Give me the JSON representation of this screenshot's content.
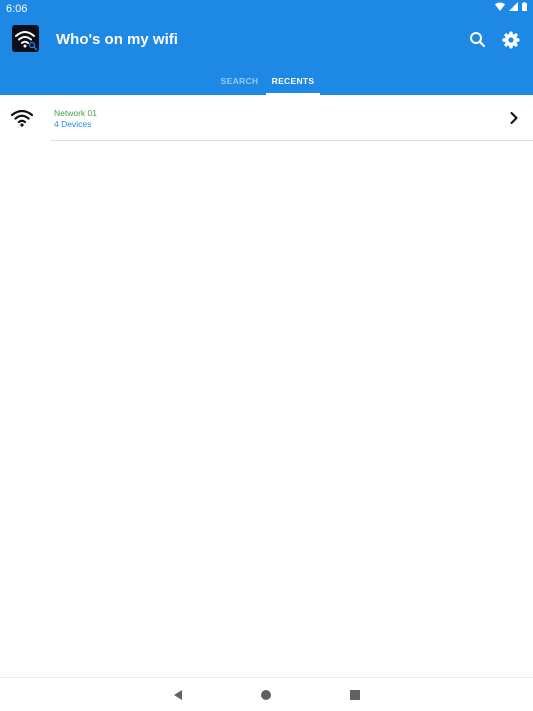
{
  "status_bar": {
    "time": "6:06",
    "icons": [
      "wifi-icon",
      "signal-icon",
      "battery-icon"
    ]
  },
  "app_bar": {
    "title": "Who's on my wifi",
    "actions": [
      "search-icon",
      "gear-icon"
    ],
    "color": "#1e88e5"
  },
  "tabs": [
    {
      "label": "SEARCH",
      "selected": false
    },
    {
      "label": "RECENTS",
      "selected": true
    }
  ],
  "networks": [
    {
      "name": "Network 01",
      "devices": "4 Devices",
      "icon": "wifi-icon"
    }
  ],
  "nav_bar": {
    "buttons": [
      "back-icon",
      "home-icon",
      "recents-icon"
    ]
  }
}
